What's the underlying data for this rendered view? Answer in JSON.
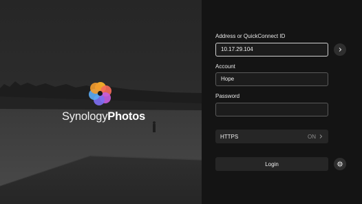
{
  "brand": {
    "name_light": "Synology",
    "name_bold": "Photos",
    "logo_icon": "synology-photos-flower-icon"
  },
  "form": {
    "address": {
      "label": "Address or QuickConnect ID",
      "value": "10.17.29.104"
    },
    "account": {
      "label": "Account",
      "value": "Hope"
    },
    "password": {
      "label": "Password",
      "value": ""
    },
    "https": {
      "label": "HTTPS",
      "value": "ON"
    },
    "login_label": "Login"
  },
  "icons": {
    "go": "chevron-right-icon",
    "settings": "gear-icon",
    "https_chevron": "chevron-right-icon"
  }
}
